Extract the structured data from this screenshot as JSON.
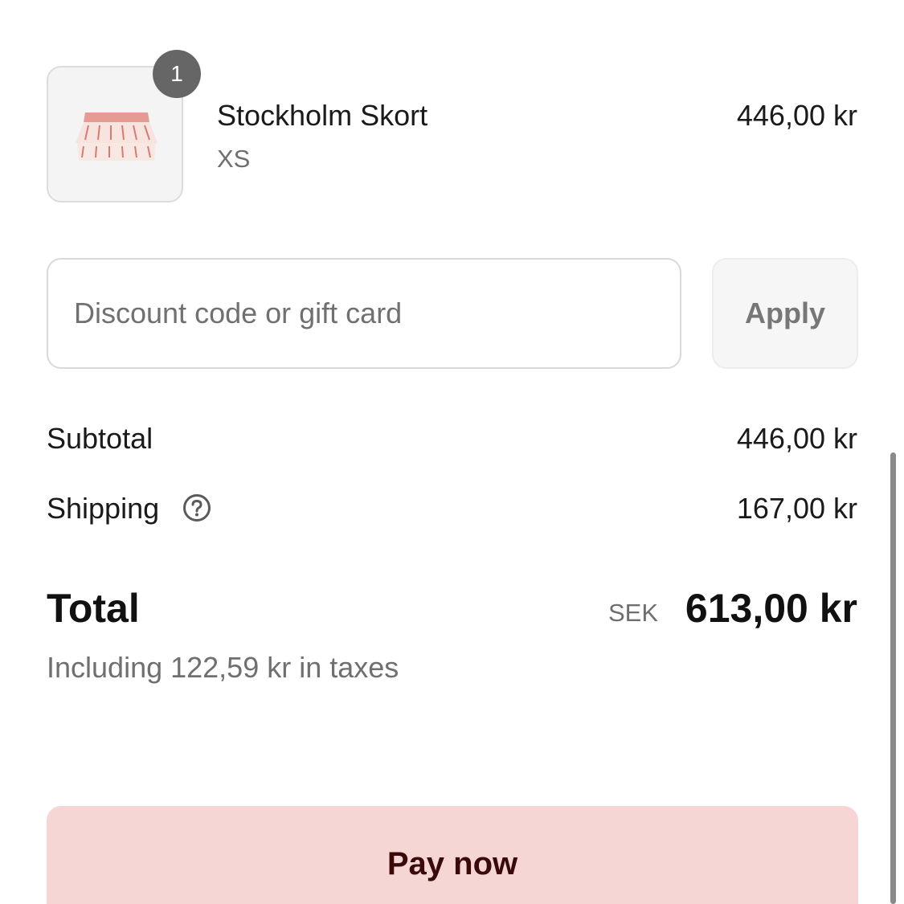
{
  "line_item": {
    "quantity": "1",
    "name": "Stockholm Skort",
    "variant": "XS",
    "price": "446,00 kr",
    "thumbnail_icon": "skort-product-image"
  },
  "discount": {
    "placeholder": "Discount code or gift card",
    "value": "",
    "apply_label": "Apply"
  },
  "summary": {
    "subtotal_label": "Subtotal",
    "subtotal_value": "446,00 kr",
    "shipping_label": "Shipping",
    "shipping_icon": "help-icon",
    "shipping_value": "167,00 kr",
    "total_label": "Total",
    "currency": "SEK",
    "total_value": "613,00 kr",
    "taxes_note": "Including 122,59 kr in taxes"
  },
  "pay_button": {
    "label": "Pay now",
    "color": "#f6d5d5"
  }
}
